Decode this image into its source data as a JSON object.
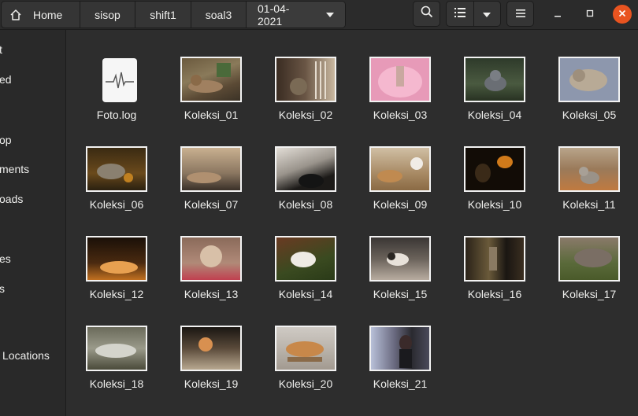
{
  "pathbar": {
    "crumbs": [
      "Home",
      "sisop",
      "shift1",
      "soal3",
      "01-04-2021"
    ]
  },
  "icons": {
    "home": "home-icon",
    "dropdown": "chevron-down-icon",
    "search": "search-icon",
    "view_list": "list-view-icon",
    "view_options": "chevron-down-icon",
    "menu": "hamburger-menu-icon",
    "minimize": "minimize-icon",
    "maximize": "maximize-icon",
    "close": "close-icon"
  },
  "colors": {
    "accent_close": "#e95420",
    "background": "#2d2d2d",
    "sidebar": "#292929"
  },
  "sidebar": {
    "items": [
      "t",
      "ed",
      "op",
      "ments",
      "oads",
      "es",
      "s",
      "Locations"
    ]
  },
  "files": [
    {
      "name": "Foto.log",
      "kind": "log"
    },
    {
      "name": "Koleksi_01",
      "kind": "image"
    },
    {
      "name": "Koleksi_02",
      "kind": "image"
    },
    {
      "name": "Koleksi_03",
      "kind": "image"
    },
    {
      "name": "Koleksi_04",
      "kind": "image"
    },
    {
      "name": "Koleksi_05",
      "kind": "image"
    },
    {
      "name": "Koleksi_06",
      "kind": "image"
    },
    {
      "name": "Koleksi_07",
      "kind": "image"
    },
    {
      "name": "Koleksi_08",
      "kind": "image"
    },
    {
      "name": "Koleksi_09",
      "kind": "image"
    },
    {
      "name": "Koleksi_10",
      "kind": "image"
    },
    {
      "name": "Koleksi_11",
      "kind": "image"
    },
    {
      "name": "Koleksi_12",
      "kind": "image"
    },
    {
      "name": "Koleksi_13",
      "kind": "image"
    },
    {
      "name": "Koleksi_14",
      "kind": "image"
    },
    {
      "name": "Koleksi_15",
      "kind": "image"
    },
    {
      "name": "Koleksi_16",
      "kind": "image"
    },
    {
      "name": "Koleksi_17",
      "kind": "image"
    },
    {
      "name": "Koleksi_18",
      "kind": "image"
    },
    {
      "name": "Koleksi_19",
      "kind": "image"
    },
    {
      "name": "Koleksi_20",
      "kind": "image"
    },
    {
      "name": "Koleksi_21",
      "kind": "image"
    }
  ]
}
